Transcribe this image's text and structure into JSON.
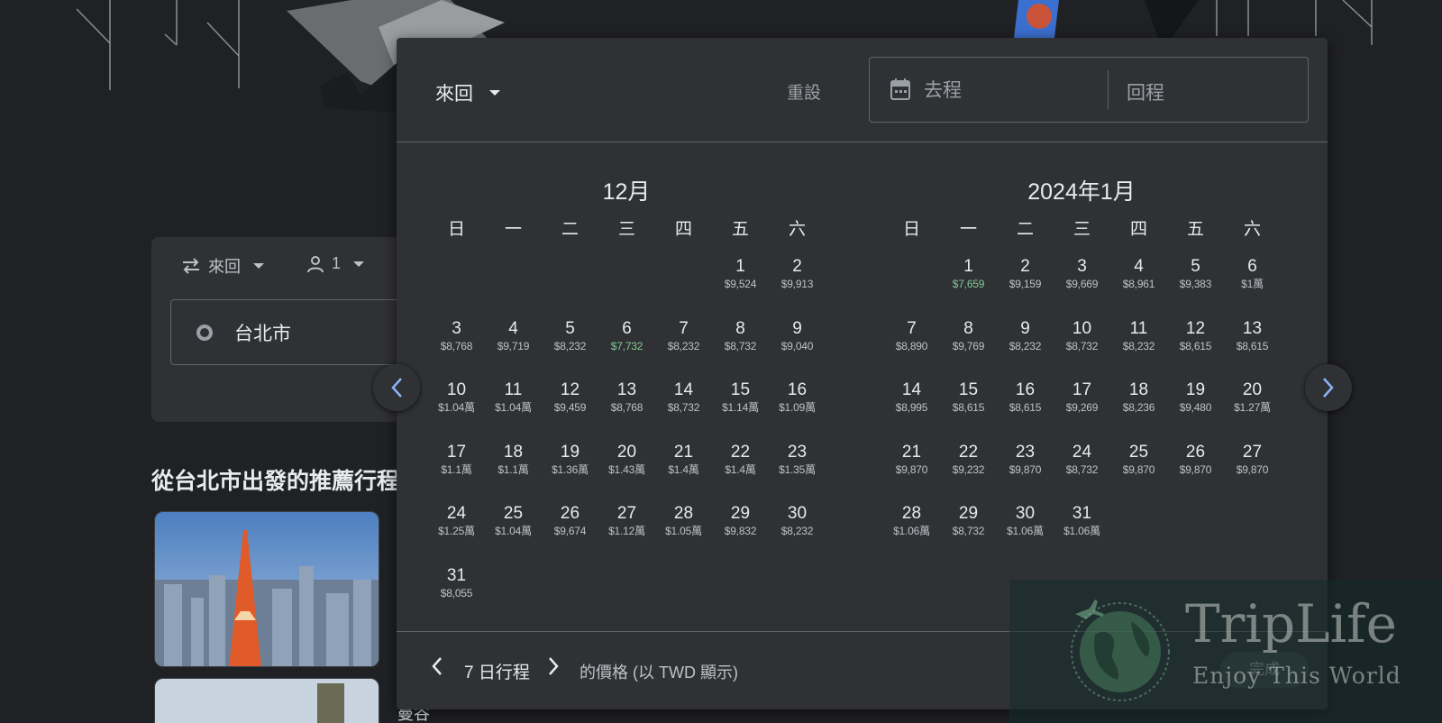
{
  "background": {
    "trip_type": "來回",
    "passengers": "1",
    "origin": "台北市",
    "recommend_title": "從台北市出發的推薦行程",
    "card2_title": "曼谷"
  },
  "dialog": {
    "trip_type": "來回",
    "reset": "重設",
    "depart_placeholder": "去程",
    "return_placeholder": "回程",
    "weekdays": [
      "日",
      "一",
      "二",
      "三",
      "四",
      "五",
      "六"
    ],
    "months": [
      {
        "title": "12月",
        "offset": 5,
        "days": [
          {
            "d": "1",
            "p": "$9,524"
          },
          {
            "d": "2",
            "p": "$9,913"
          },
          {
            "d": "3",
            "p": "$8,768"
          },
          {
            "d": "4",
            "p": "$9,719"
          },
          {
            "d": "5",
            "p": "$8,232"
          },
          {
            "d": "6",
            "p": "$7,732",
            "low": true
          },
          {
            "d": "7",
            "p": "$8,232"
          },
          {
            "d": "8",
            "p": "$8,732"
          },
          {
            "d": "9",
            "p": "$9,040"
          },
          {
            "d": "10",
            "p": "$1.04萬"
          },
          {
            "d": "11",
            "p": "$1.04萬"
          },
          {
            "d": "12",
            "p": "$9,459"
          },
          {
            "d": "13",
            "p": "$8,768"
          },
          {
            "d": "14",
            "p": "$8,732"
          },
          {
            "d": "15",
            "p": "$1.14萬"
          },
          {
            "d": "16",
            "p": "$1.09萬"
          },
          {
            "d": "17",
            "p": "$1.1萬"
          },
          {
            "d": "18",
            "p": "$1.1萬"
          },
          {
            "d": "19",
            "p": "$1.36萬"
          },
          {
            "d": "20",
            "p": "$1.43萬"
          },
          {
            "d": "21",
            "p": "$1.4萬"
          },
          {
            "d": "22",
            "p": "$1.4萬"
          },
          {
            "d": "23",
            "p": "$1.35萬"
          },
          {
            "d": "24",
            "p": "$1.25萬"
          },
          {
            "d": "25",
            "p": "$1.04萬"
          },
          {
            "d": "26",
            "p": "$9,674"
          },
          {
            "d": "27",
            "p": "$1.12萬"
          },
          {
            "d": "28",
            "p": "$1.05萬"
          },
          {
            "d": "29",
            "p": "$9,832"
          },
          {
            "d": "30",
            "p": "$8,232"
          },
          {
            "d": "31",
            "p": "$8,055"
          }
        ]
      },
      {
        "title": "2024年1月",
        "offset": 1,
        "days": [
          {
            "d": "1",
            "p": "$7,659",
            "low": true
          },
          {
            "d": "2",
            "p": "$9,159"
          },
          {
            "d": "3",
            "p": "$9,669"
          },
          {
            "d": "4",
            "p": "$8,961"
          },
          {
            "d": "5",
            "p": "$9,383"
          },
          {
            "d": "6",
            "p": "$1萬"
          },
          {
            "d": "7",
            "p": "$8,890"
          },
          {
            "d": "8",
            "p": "$9,769"
          },
          {
            "d": "9",
            "p": "$8,232"
          },
          {
            "d": "10",
            "p": "$8,732"
          },
          {
            "d": "11",
            "p": "$8,232"
          },
          {
            "d": "12",
            "p": "$8,615"
          },
          {
            "d": "13",
            "p": "$8,615"
          },
          {
            "d": "14",
            "p": "$8,995"
          },
          {
            "d": "15",
            "p": "$8,615"
          },
          {
            "d": "16",
            "p": "$8,615"
          },
          {
            "d": "17",
            "p": "$9,269"
          },
          {
            "d": "18",
            "p": "$8,236"
          },
          {
            "d": "19",
            "p": "$9,480"
          },
          {
            "d": "20",
            "p": "$1.27萬"
          },
          {
            "d": "21",
            "p": "$9,870"
          },
          {
            "d": "22",
            "p": "$9,232"
          },
          {
            "d": "23",
            "p": "$9,870"
          },
          {
            "d": "24",
            "p": "$8,732"
          },
          {
            "d": "25",
            "p": "$9,870"
          },
          {
            "d": "26",
            "p": "$9,870"
          },
          {
            "d": "27",
            "p": "$9,870"
          },
          {
            "d": "28",
            "p": "$1.06萬"
          },
          {
            "d": "29",
            "p": "$8,732"
          },
          {
            "d": "30",
            "p": "$1.06萬"
          },
          {
            "d": "31",
            "p": "$1.06萬"
          }
        ]
      }
    ],
    "footer": {
      "duration": "7 日行程",
      "currency_note": "的價格 (以 TWD 顯示)",
      "done": "完成"
    }
  },
  "watermark": {
    "title": "TripLife",
    "subtitle": "Enjoy This World"
  },
  "icons": {
    "swap": "swap-icon",
    "person": "person-icon",
    "calendar": "calendar-icon",
    "prev": "chevron-left-icon",
    "next": "chevron-right-icon",
    "globe": "globe-plane-icon"
  },
  "colors": {
    "background": "#202124",
    "surface": "#303134",
    "low_price": "#81c995",
    "accent": "#8ab4f8"
  }
}
